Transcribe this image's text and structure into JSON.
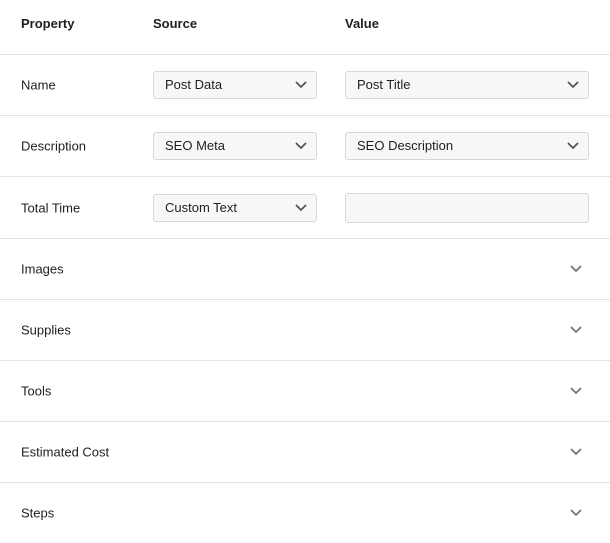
{
  "header": {
    "property": "Property",
    "source": "Source",
    "value": "Value"
  },
  "fields": [
    {
      "label": "Name",
      "source": "Post Data",
      "value": "Post Title"
    },
    {
      "label": "Description",
      "source": "SEO Meta",
      "value": "SEO Description"
    },
    {
      "label": "Total Time",
      "source": "Custom Text",
      "value": ""
    }
  ],
  "sections": [
    {
      "label": "Images"
    },
    {
      "label": "Supplies"
    },
    {
      "label": "Tools"
    },
    {
      "label": "Estimated Cost"
    },
    {
      "label": "Steps"
    }
  ],
  "icons": {
    "dropdown": "chevron-down-icon",
    "expand": "chevron-down-icon"
  },
  "colors": {
    "border": "#e2e4e7",
    "field_bg": "#f7f7f7",
    "text": "#1e1e1e",
    "chevron": "#757575"
  }
}
